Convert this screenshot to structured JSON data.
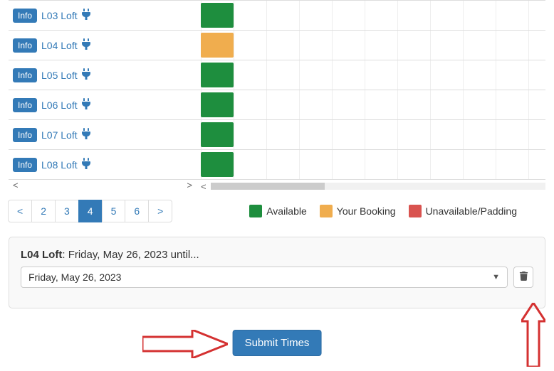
{
  "rooms": [
    {
      "info": "Info",
      "name": "L03 Loft",
      "status": "available"
    },
    {
      "info": "Info",
      "name": "L04 Loft",
      "status": "your_booking"
    },
    {
      "info": "Info",
      "name": "L05 Loft",
      "status": "available"
    },
    {
      "info": "Info",
      "name": "L06 Loft",
      "status": "available"
    },
    {
      "info": "Info",
      "name": "L07 Loft",
      "status": "available"
    },
    {
      "info": "Info",
      "name": "L08 Loft",
      "status": "available"
    }
  ],
  "status_colors": {
    "available": "#1e8e3e",
    "your_booking": "#f0ad4e"
  },
  "pagination": {
    "prev": "<",
    "pages": [
      "2",
      "3",
      "4",
      "5",
      "6"
    ],
    "active": "4",
    "next": ">"
  },
  "legend": {
    "available": "Available",
    "your_booking": "Your Booking",
    "unavailable": "Unavailable/Padding"
  },
  "selection": {
    "room": "L04 Loft",
    "separator": ": ",
    "date_label": "Friday, May 26, 2023 until...",
    "dropdown_value": "Friday, May 26, 2023"
  },
  "submit_label": "Submit Times",
  "scroll": {
    "left": "<",
    "right": ">"
  }
}
